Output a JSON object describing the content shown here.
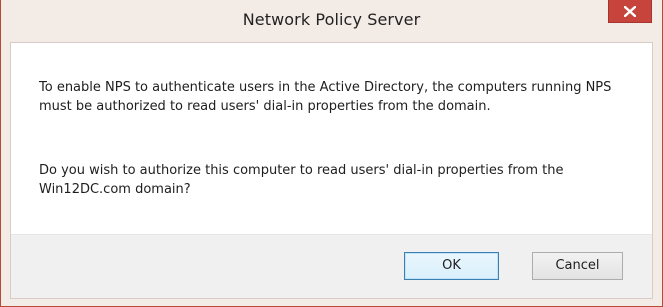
{
  "window": {
    "title": "Network Policy Server"
  },
  "titlebar": {
    "close_icon": "close-icon",
    "close_color": "#c6443c"
  },
  "message": {
    "line1": "To enable NPS to authenticate users in the Active Directory, the computers running NPS must be authorized to read users' dial-in properties from the domain.",
    "line2": "Do you wish to authorize this computer to read users' dial-in  properties from the Win12DC.com domain?"
  },
  "buttons": {
    "ok_label": "OK",
    "cancel_label": "Cancel"
  }
}
